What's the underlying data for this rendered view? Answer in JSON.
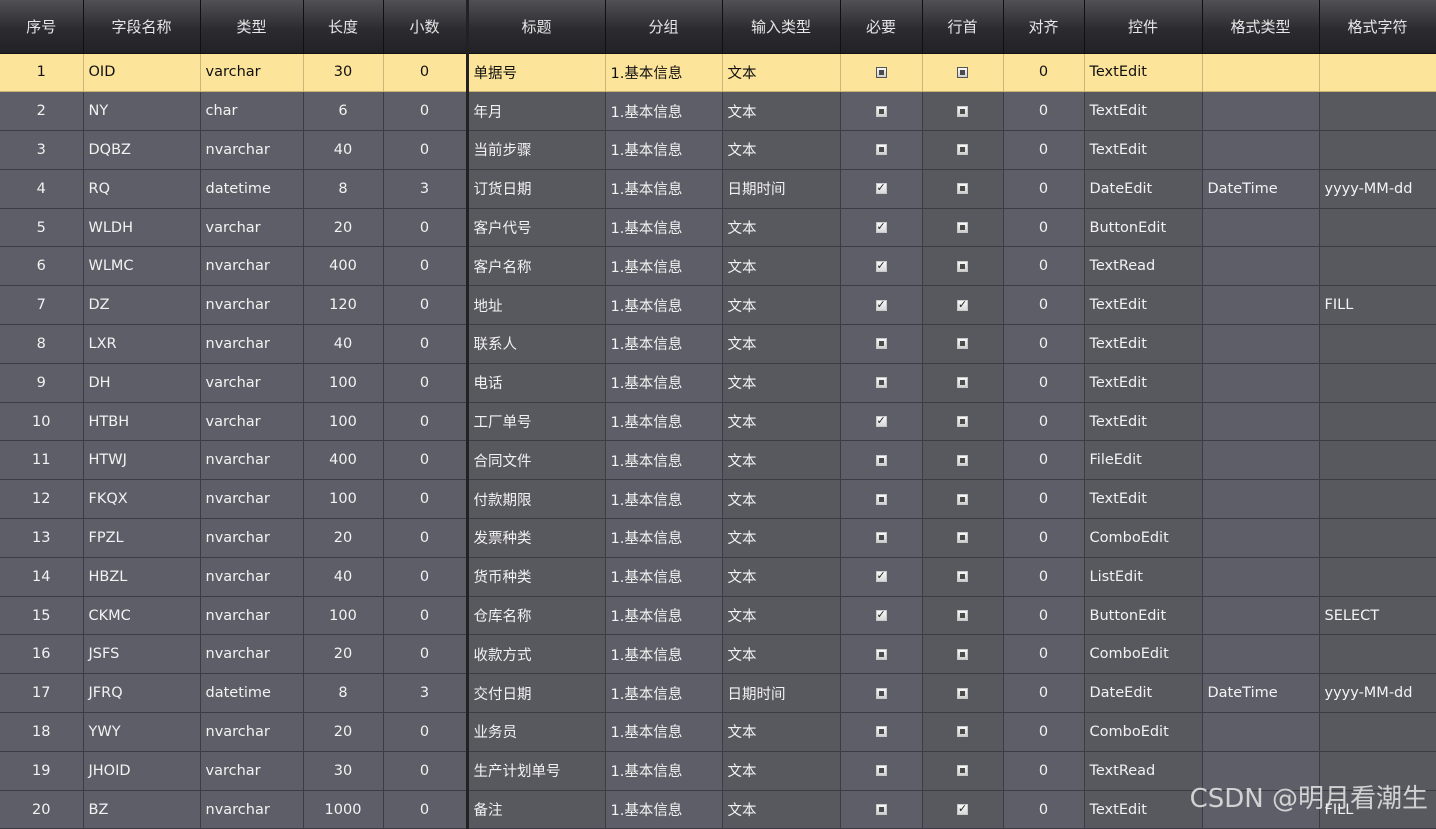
{
  "columns": [
    "序号",
    "字段名称",
    "类型",
    "长度",
    "小数",
    "标题",
    "分组",
    "输入类型",
    "必要",
    "行首",
    "对齐",
    "控件",
    "格式类型",
    "格式字符"
  ],
  "rows": [
    {
      "no": "1",
      "field": "OID",
      "type": "varchar",
      "len": "30",
      "dec": "0",
      "title": "单据号",
      "group": "1.基本信息",
      "input": "文本",
      "req": false,
      "head": false,
      "align": "0",
      "ctrl": "TextEdit",
      "fmt_type": "",
      "fmt_str": ""
    },
    {
      "no": "2",
      "field": "NY",
      "type": "char",
      "len": "6",
      "dec": "0",
      "title": "年月",
      "group": "1.基本信息",
      "input": "文本",
      "req": false,
      "head": false,
      "align": "0",
      "ctrl": "TextEdit",
      "fmt_type": "",
      "fmt_str": ""
    },
    {
      "no": "3",
      "field": "DQBZ",
      "type": "nvarchar",
      "len": "40",
      "dec": "0",
      "title": "当前步骤",
      "group": "1.基本信息",
      "input": "文本",
      "req": false,
      "head": false,
      "align": "0",
      "ctrl": "TextEdit",
      "fmt_type": "",
      "fmt_str": ""
    },
    {
      "no": "4",
      "field": "RQ",
      "type": "datetime",
      "len": "8",
      "dec": "3",
      "title": "订货日期",
      "group": "1.基本信息",
      "input": "日期时间",
      "req": true,
      "head": false,
      "align": "0",
      "ctrl": "DateEdit",
      "fmt_type": "DateTime",
      "fmt_str": "yyyy-MM-dd"
    },
    {
      "no": "5",
      "field": "WLDH",
      "type": "varchar",
      "len": "20",
      "dec": "0",
      "title": "客户代号",
      "group": "1.基本信息",
      "input": "文本",
      "req": true,
      "head": false,
      "align": "0",
      "ctrl": "ButtonEdit",
      "fmt_type": "",
      "fmt_str": ""
    },
    {
      "no": "6",
      "field": "WLMC",
      "type": "nvarchar",
      "len": "400",
      "dec": "0",
      "title": "客户名称",
      "group": "1.基本信息",
      "input": "文本",
      "req": true,
      "head": false,
      "align": "0",
      "ctrl": "TextRead",
      "fmt_type": "",
      "fmt_str": ""
    },
    {
      "no": "7",
      "field": "DZ",
      "type": "nvarchar",
      "len": "120",
      "dec": "0",
      "title": "地址",
      "group": "1.基本信息",
      "input": "文本",
      "req": true,
      "head": true,
      "align": "0",
      "ctrl": "TextEdit",
      "fmt_type": "",
      "fmt_str": "FILL"
    },
    {
      "no": "8",
      "field": "LXR",
      "type": "nvarchar",
      "len": "40",
      "dec": "0",
      "title": "联系人",
      "group": "1.基本信息",
      "input": "文本",
      "req": false,
      "head": false,
      "align": "0",
      "ctrl": "TextEdit",
      "fmt_type": "",
      "fmt_str": ""
    },
    {
      "no": "9",
      "field": "DH",
      "type": "varchar",
      "len": "100",
      "dec": "0",
      "title": "电话",
      "group": "1.基本信息",
      "input": "文本",
      "req": false,
      "head": false,
      "align": "0",
      "ctrl": "TextEdit",
      "fmt_type": "",
      "fmt_str": ""
    },
    {
      "no": "10",
      "field": "HTBH",
      "type": "varchar",
      "len": "100",
      "dec": "0",
      "title": "工厂单号",
      "group": "1.基本信息",
      "input": "文本",
      "req": true,
      "head": false,
      "align": "0",
      "ctrl": "TextEdit",
      "fmt_type": "",
      "fmt_str": ""
    },
    {
      "no": "11",
      "field": "HTWJ",
      "type": "nvarchar",
      "len": "400",
      "dec": "0",
      "title": "合同文件",
      "group": "1.基本信息",
      "input": "文本",
      "req": false,
      "head": false,
      "align": "0",
      "ctrl": "FileEdit",
      "fmt_type": "",
      "fmt_str": ""
    },
    {
      "no": "12",
      "field": "FKQX",
      "type": "nvarchar",
      "len": "100",
      "dec": "0",
      "title": "付款期限",
      "group": "1.基本信息",
      "input": "文本",
      "req": false,
      "head": false,
      "align": "0",
      "ctrl": "TextEdit",
      "fmt_type": "",
      "fmt_str": ""
    },
    {
      "no": "13",
      "field": "FPZL",
      "type": "nvarchar",
      "len": "20",
      "dec": "0",
      "title": "发票种类",
      "group": "1.基本信息",
      "input": "文本",
      "req": false,
      "head": false,
      "align": "0",
      "ctrl": "ComboEdit",
      "fmt_type": "",
      "fmt_str": ""
    },
    {
      "no": "14",
      "field": "HBZL",
      "type": "nvarchar",
      "len": "40",
      "dec": "0",
      "title": "货币种类",
      "group": "1.基本信息",
      "input": "文本",
      "req": true,
      "head": false,
      "align": "0",
      "ctrl": "ListEdit",
      "fmt_type": "",
      "fmt_str": ""
    },
    {
      "no": "15",
      "field": "CKMC",
      "type": "nvarchar",
      "len": "100",
      "dec": "0",
      "title": "仓库名称",
      "group": "1.基本信息",
      "input": "文本",
      "req": true,
      "head": false,
      "align": "0",
      "ctrl": "ButtonEdit",
      "fmt_type": "",
      "fmt_str": "SELECT"
    },
    {
      "no": "16",
      "field": "JSFS",
      "type": "nvarchar",
      "len": "20",
      "dec": "0",
      "title": "收款方式",
      "group": "1.基本信息",
      "input": "文本",
      "req": false,
      "head": false,
      "align": "0",
      "ctrl": "ComboEdit",
      "fmt_type": "",
      "fmt_str": ""
    },
    {
      "no": "17",
      "field": "JFRQ",
      "type": "datetime",
      "len": "8",
      "dec": "3",
      "title": "交付日期",
      "group": "1.基本信息",
      "input": "日期时间",
      "req": false,
      "head": false,
      "align": "0",
      "ctrl": "DateEdit",
      "fmt_type": "DateTime",
      "fmt_str": "yyyy-MM-dd"
    },
    {
      "no": "18",
      "field": "YWY",
      "type": "nvarchar",
      "len": "20",
      "dec": "0",
      "title": "业务员",
      "group": "1.基本信息",
      "input": "文本",
      "req": false,
      "head": false,
      "align": "0",
      "ctrl": "ComboEdit",
      "fmt_type": "",
      "fmt_str": ""
    },
    {
      "no": "19",
      "field": "JHOID",
      "type": "varchar",
      "len": "30",
      "dec": "0",
      "title": "生产计划单号",
      "group": "1.基本信息",
      "input": "文本",
      "req": false,
      "head": false,
      "align": "0",
      "ctrl": "TextRead",
      "fmt_type": "",
      "fmt_str": ""
    },
    {
      "no": "20",
      "field": "BZ",
      "type": "nvarchar",
      "len": "1000",
      "dec": "0",
      "title": "备注",
      "group": "1.基本信息",
      "input": "文本",
      "req": false,
      "head": true,
      "align": "0",
      "ctrl": "TextEdit",
      "fmt_type": "",
      "fmt_str": "FILL"
    }
  ],
  "selected_row": 0,
  "watermark": "CSDN @明月看潮生",
  "colors": {
    "header_bg": "#2c2c30",
    "row_bg": "#5e5e68",
    "selected_bg": "#fde49b",
    "text": "#f2f2f2"
  }
}
